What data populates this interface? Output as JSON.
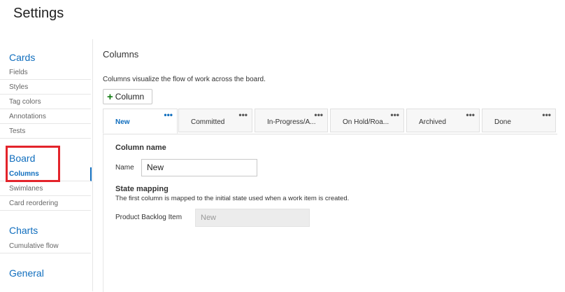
{
  "page": {
    "title": "Settings"
  },
  "sidebar": {
    "sections": [
      {
        "title": "Cards",
        "items": [
          "Fields",
          "Styles",
          "Tag colors",
          "Annotations",
          "Tests"
        ]
      },
      {
        "title": "Board",
        "items": [
          "Columns",
          "Swimlanes",
          "Card reordering"
        ],
        "active_item": "Columns"
      },
      {
        "title": "Charts",
        "items": [
          "Cumulative flow"
        ]
      },
      {
        "title": "General",
        "items": []
      }
    ]
  },
  "main": {
    "heading": "Columns",
    "description": "Columns visualize the flow of work across the board.",
    "add_column_label": "Column",
    "tabs": [
      {
        "label": "New",
        "active": true
      },
      {
        "label": "Committed",
        "active": false
      },
      {
        "label": "In-Progress/A...",
        "active": false
      },
      {
        "label": "On Hold/Roa...",
        "active": false
      },
      {
        "label": "Archived",
        "active": false
      },
      {
        "label": "Done",
        "active": false
      }
    ],
    "tab_menu_glyph": "•••",
    "panel": {
      "column_name_heading": "Column name",
      "name_label": "Name",
      "name_value": "New",
      "state_mapping_heading": "State mapping",
      "state_mapping_hint": "The first column is mapped to the initial state used when a work item is created.",
      "product_backlog_label": "Product Backlog Item",
      "product_backlog_value": "New"
    }
  },
  "colors": {
    "accent": "#106ebe",
    "highlight": "#e3242b",
    "add_icon": "#107c10"
  }
}
